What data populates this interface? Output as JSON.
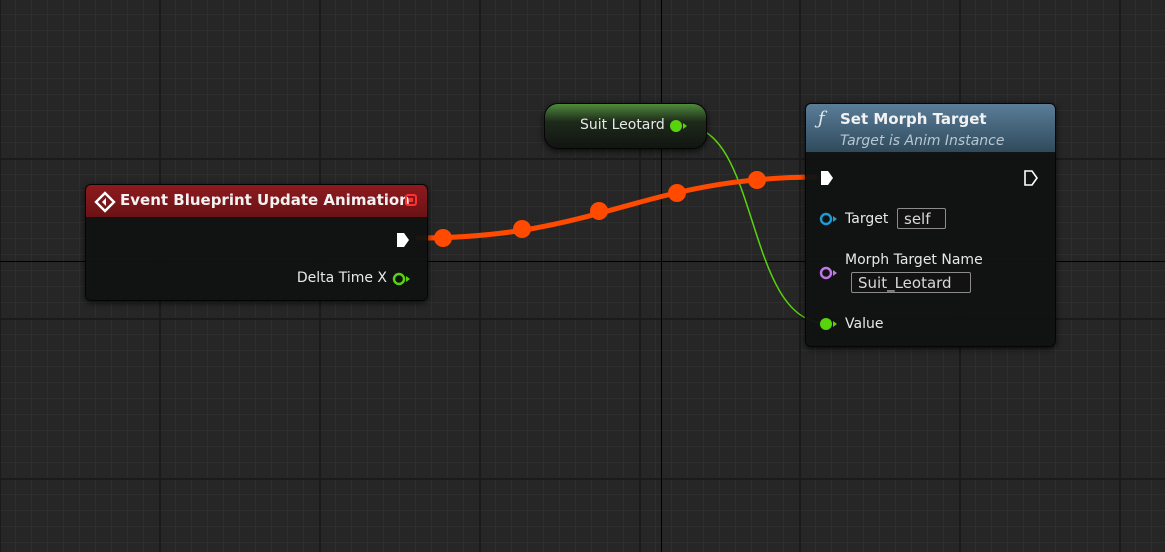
{
  "event_node": {
    "title": "Event Blueprint Update Animation",
    "output_label": "Delta Time X"
  },
  "variable_node": {
    "label": "Suit Leotard"
  },
  "function_node": {
    "title": "Set Morph Target",
    "subtitle": "Target is Anim Instance",
    "target_label": "Target",
    "target_value": "self",
    "morph_name_label": "Morph Target Name",
    "morph_name_value": "Suit_Leotard",
    "value_label": "Value"
  },
  "colors": {
    "exec_wire": "#ff4a00",
    "float_pin": "#8cd642",
    "bool_pin": "#58d40c",
    "object_pin": "#1e9ad6",
    "name_pin": "#c276e8",
    "event_header": "#8e1a1e",
    "function_header": "#5a7d98",
    "variable_header": "#4f8b3c"
  },
  "icons": {
    "event": "event-diamond-icon",
    "function": "function-f-icon",
    "delegate": "delegate-square-icon"
  }
}
